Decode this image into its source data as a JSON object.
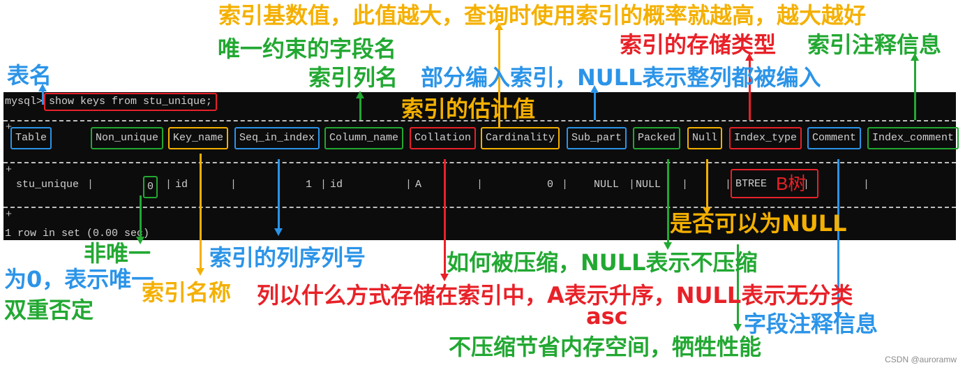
{
  "terminal": {
    "prompt": "mysql>",
    "command": "show keys from stu_unique;",
    "border_corner": "+",
    "col_sep": "|",
    "columns": [
      "Table",
      "Non_unique",
      "Key_name",
      "Seq_in_index",
      "Column_name",
      "Collation",
      "Cardinality",
      "Sub_part",
      "Packed",
      "Null",
      "Index_type",
      "Comment",
      "Index_comment"
    ],
    "row": {
      "table": "stu_unique",
      "non_unique": "0",
      "key_name": "id",
      "seq_in_index": "1",
      "column_name": "id",
      "collation": "A",
      "cardinality": "0",
      "sub_part": "NULL",
      "packed": "NULL",
      "null": "",
      "index_type": "BTREE",
      "comment": "",
      "index_comment": ""
    },
    "footer": "1 row in set (0.00 sec)"
  },
  "annotations": {
    "cardinality_note": "索引基数值，此值越大，查询时使用索引的概率就越高，越大越好",
    "unique_field_name": "唯一约束的字段名",
    "table_name": "表名",
    "index_type_note": "索引的存储类型",
    "index_comment_note": "索引注释信息",
    "column_name_note": "索引列名",
    "sub_part_note": "部分编入索引，NULL表示整列都被编入",
    "cardinality_estimate": "索引的估计值",
    "btree_note": "B树",
    "null_note": "是否可以为NULL",
    "non_unique_note": "非唯一",
    "seq_note": "索引的列序列号",
    "packed_note": "如何被压缩，NULL表示不压缩",
    "zero_note": "为0，表示唯一",
    "double_neg_note": "双重否定",
    "key_name_note": "索引名称",
    "collation_note": "列以什么方式存储在索引中，A表示升序，NULL表示无分类",
    "asc_note": "asc",
    "comment_note": "字段注释信息",
    "no_compress_note": "不压缩节省内存空间，牺牲性能"
  },
  "watermark": "CSDN @auroramw",
  "colors": {
    "blue": "#2b94e8",
    "green": "#22a832",
    "yellow": "#f4b000",
    "red": "#e82128",
    "terminal_bg": "#0c0c0c"
  }
}
